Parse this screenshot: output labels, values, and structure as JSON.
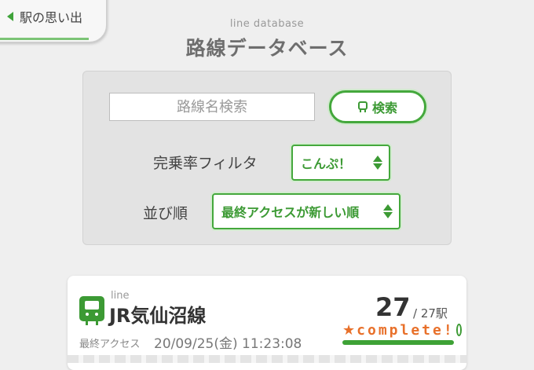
{
  "header": {
    "back_label": "駅の思い出",
    "sub_title": "line database",
    "title": "路線データベース"
  },
  "search": {
    "placeholder": "路線名検索",
    "button_label": "検索"
  },
  "filters": {
    "completion_label": "完乗率フィルタ",
    "completion_value": "こんぷ！",
    "sort_label": "並び順",
    "sort_value": "最終アクセスが新しい順"
  },
  "line_card": {
    "tag": "line",
    "name": "JR気仙沼線",
    "visited": "27",
    "total_text": "/ 27駅",
    "complete_text": "complete!",
    "progress": 1.0,
    "last_access_label": "最終アクセス",
    "last_access_value": "20/09/25(金) 11:23:08"
  },
  "colors": {
    "accent_green": "#44a83c",
    "complete_orange": "#e8702a",
    "background": "#efefef"
  }
}
